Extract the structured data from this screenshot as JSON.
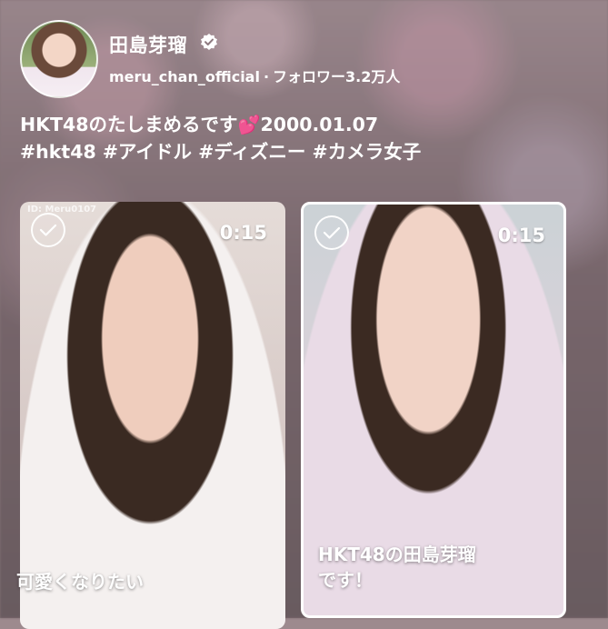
{
  "profile": {
    "name": "田島芽瑠",
    "handle": "meru_chan_official",
    "separator": "·",
    "followers": "フォロワー3.2万人",
    "bio_line1": "HKT48のたしまめるです",
    "bio_emoji": "💕",
    "bio_date": "2000.01.07",
    "bio_line2": "#hkt48 #アイドル #ディズニー #カメラ女子"
  },
  "videos": [
    {
      "duration": "0:15",
      "watermark": "ID: Meru0107",
      "caption": "可愛くなりたい",
      "selected": false
    },
    {
      "duration": "0:15",
      "caption_line1": "HKT48の田島芽瑠",
      "caption_line2": "です！",
      "selected": true
    }
  ],
  "icons": {
    "verified": "verified-badge-icon",
    "check": "check-icon"
  },
  "colors": {
    "heart": "#ff5eb0",
    "selected_border": "#ffffff"
  }
}
